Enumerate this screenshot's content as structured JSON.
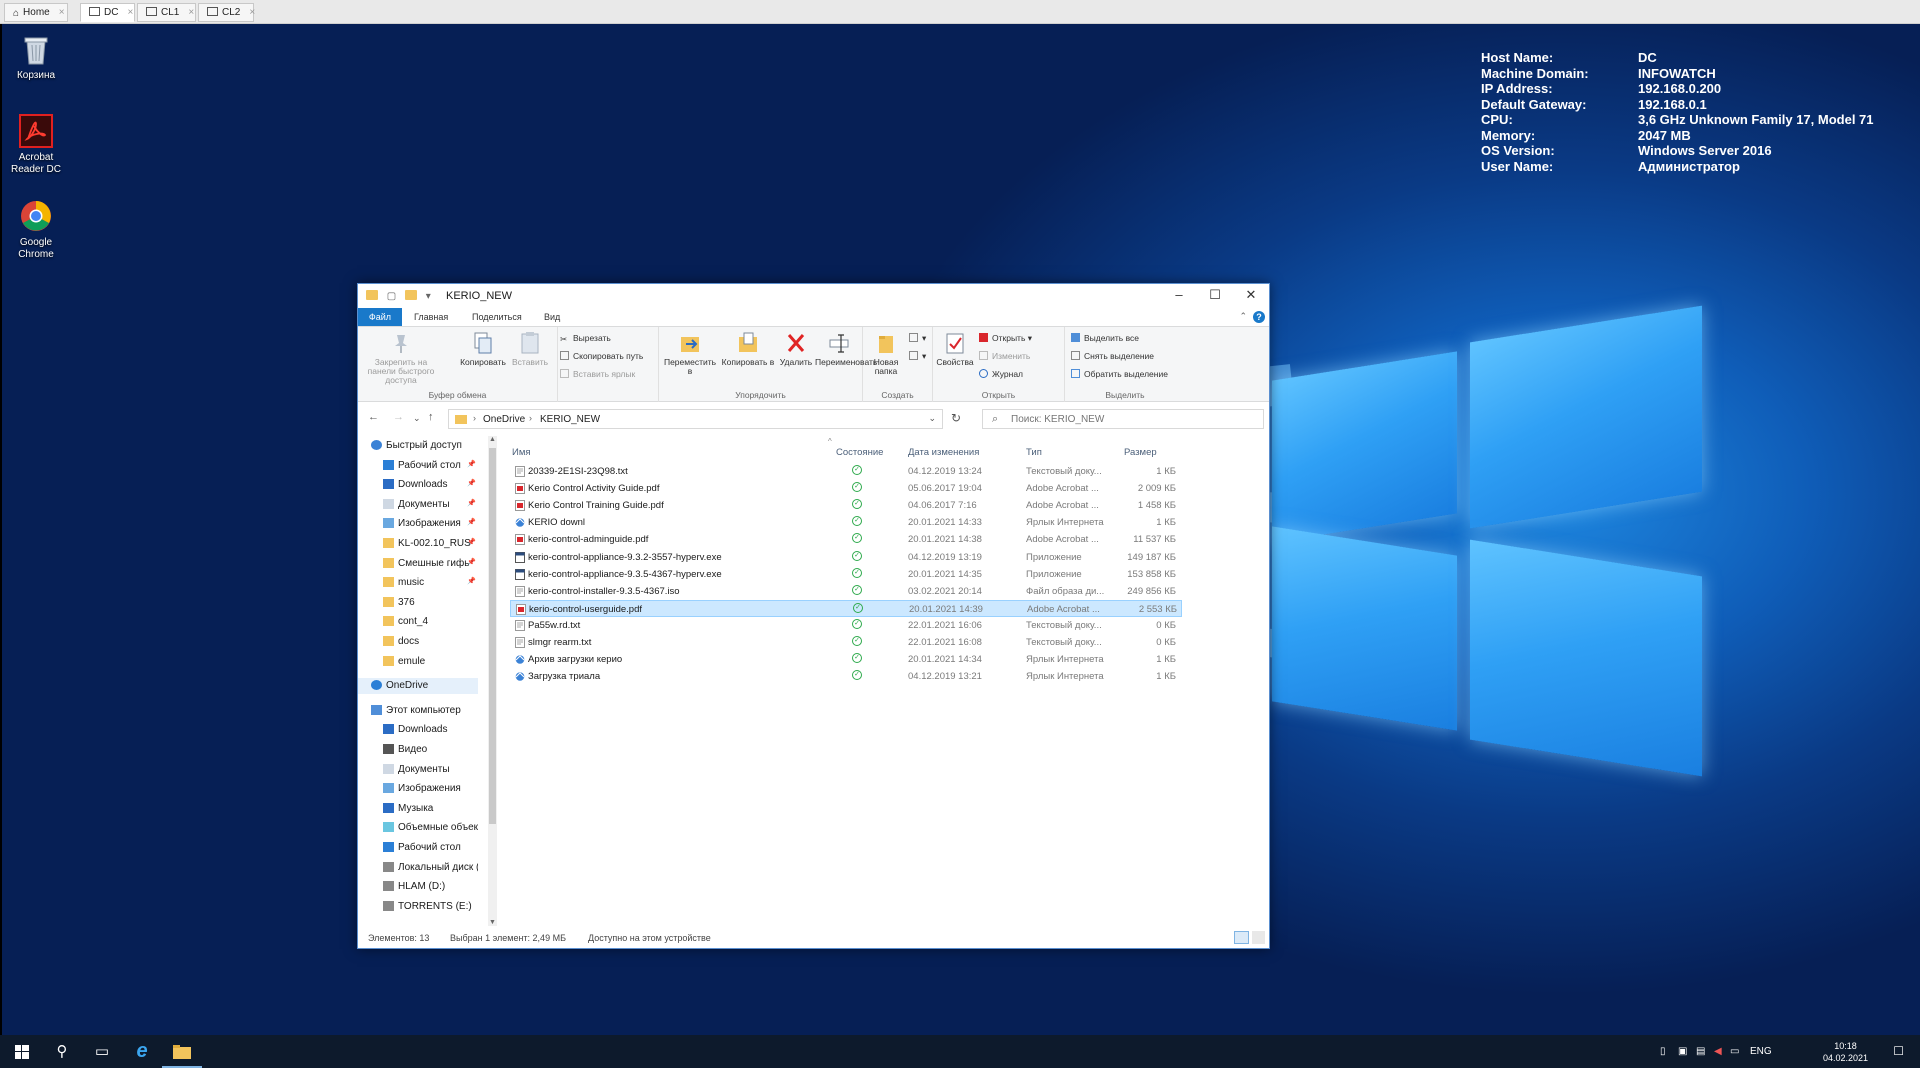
{
  "vm_tabs": [
    {
      "label": "Home",
      "active": false
    },
    {
      "label": "DC",
      "active": true
    },
    {
      "label": "CL1",
      "active": false
    },
    {
      "label": "CL2",
      "active": false
    }
  ],
  "desktop": {
    "icons": [
      {
        "label": "Корзина",
        "icon": "recycle-bin-icon"
      },
      {
        "label": "Acrobat Reader DC",
        "icon": "acrobat-icon"
      },
      {
        "label": "Google Chrome",
        "icon": "chrome-icon"
      }
    ],
    "sysinfo": [
      {
        "k": "Host Name:",
        "v": "DC"
      },
      {
        "k": "Machine Domain:",
        "v": "INFOWATCH"
      },
      {
        "k": "IP Address:",
        "v": "192.168.0.200"
      },
      {
        "k": "Default Gateway:",
        "v": "192.168.0.1"
      },
      {
        "k": "CPU:",
        "v": "3,6 GHz Unknown Family 17, Model 71"
      },
      {
        "k": "Memory:",
        "v": "2047 MB"
      },
      {
        "k": "OS Version:",
        "v": "Windows Server 2016"
      },
      {
        "k": "User Name:",
        "v": "Администратор"
      }
    ]
  },
  "explorer": {
    "title": "KERIO_NEW",
    "ribbon_tabs": [
      "Файл",
      "Главная",
      "Поделиться",
      "Вид"
    ],
    "ribbon": {
      "pin": "Закрепить на панели быстрого доступа",
      "copy": "Копировать",
      "paste": "Вставить",
      "cut": "Вырезать",
      "copy_path": "Скопировать путь",
      "paste_shortcut": "Вставить ярлык",
      "group_clipboard": "Буфер обмена",
      "move_to": "Переместить в",
      "copy_to": "Копировать в",
      "delete": "Удалить",
      "rename": "Переименовать",
      "group_organize": "Упорядочить",
      "new_folder": "Новая папка",
      "group_new": "Создать",
      "properties": "Свойства",
      "open": "Открыть",
      "edit": "Изменить",
      "history": "Журнал",
      "group_open": "Открыть",
      "select_all": "Выделить все",
      "select_none": "Снять выделение",
      "invert": "Обратить выделение",
      "group_select": "Выделить"
    },
    "address": {
      "parts": [
        "OneDrive",
        "KERIO_NEW"
      ]
    },
    "search": {
      "placeholder": "Поиск: KERIO_NEW"
    },
    "nav": [
      {
        "label": "Быстрый доступ",
        "indent": 0,
        "icon": "star-icon",
        "pin": false
      },
      {
        "label": "Рабочий стол",
        "indent": 1,
        "icon": "desktop-icon",
        "pin": true
      },
      {
        "label": "Downloads",
        "indent": 1,
        "icon": "download-icon",
        "pin": true
      },
      {
        "label": "Документы",
        "indent": 1,
        "icon": "documents-icon",
        "pin": true
      },
      {
        "label": "Изображения",
        "indent": 1,
        "icon": "pictures-icon",
        "pin": true
      },
      {
        "label": "KL-002.10_RUS",
        "indent": 1,
        "icon": "folder-icon",
        "pin": true
      },
      {
        "label": "Смешные гифь",
        "indent": 1,
        "icon": "folder-icon",
        "pin": true
      },
      {
        "label": "music",
        "indent": 1,
        "icon": "folder-icon",
        "pin": true
      },
      {
        "label": "376",
        "indent": 1,
        "icon": "folder-icon",
        "pin": false
      },
      {
        "label": "cont_4",
        "indent": 1,
        "icon": "folder-icon",
        "pin": false
      },
      {
        "label": "docs",
        "indent": 1,
        "icon": "folder-icon",
        "pin": false
      },
      {
        "label": "emule",
        "indent": 1,
        "icon": "folder-icon",
        "pin": false
      },
      {
        "label": "OneDrive",
        "indent": 0,
        "icon": "cloud-icon",
        "pin": false,
        "selected": true
      },
      {
        "label": "Этот компьютер",
        "indent": 0,
        "icon": "computer-icon",
        "pin": false
      },
      {
        "label": "Downloads",
        "indent": 1,
        "icon": "download-icon",
        "pin": false
      },
      {
        "label": "Видео",
        "indent": 1,
        "icon": "video-icon",
        "pin": false
      },
      {
        "label": "Документы",
        "indent": 1,
        "icon": "documents-icon",
        "pin": false
      },
      {
        "label": "Изображения",
        "indent": 1,
        "icon": "pictures-icon",
        "pin": false
      },
      {
        "label": "Музыка",
        "indent": 1,
        "icon": "music-icon",
        "pin": false
      },
      {
        "label": "Объемные объек",
        "indent": 1,
        "icon": "3d-objects-icon",
        "pin": false
      },
      {
        "label": "Рабочий стол",
        "indent": 1,
        "icon": "desktop-icon",
        "pin": false
      },
      {
        "label": "Локальный диск (",
        "indent": 1,
        "icon": "drive-icon",
        "pin": false
      },
      {
        "label": "HLAM (D:)",
        "indent": 1,
        "icon": "drive-icon",
        "pin": false
      },
      {
        "label": "TORRENTS (E:)",
        "indent": 1,
        "icon": "drive-icon",
        "pin": false
      }
    ],
    "columns": {
      "name": "Имя",
      "status": "Состояние",
      "date": "Дата изменения",
      "type": "Тип",
      "size": "Размер"
    },
    "files": [
      {
        "name": "20339-2E1SI-23Q98.txt",
        "date": "04.12.2019 13:24",
        "type": "Текстовый доку...",
        "size": "1 КБ",
        "icon": "txt"
      },
      {
        "name": "Kerio Control Activity Guide.pdf",
        "date": "05.06.2017 19:04",
        "type": "Adobe Acrobat ...",
        "size": "2 009 КБ",
        "icon": "pdf"
      },
      {
        "name": "Kerio Control Training Guide.pdf",
        "date": "04.06.2017 7:16",
        "type": "Adobe Acrobat ...",
        "size": "1 458 КБ",
        "icon": "pdf"
      },
      {
        "name": "KERIO downl",
        "date": "20.01.2021 14:33",
        "type": "Ярлык Интернета",
        "size": "1 КБ",
        "icon": "url"
      },
      {
        "name": "kerio-control-adminguide.pdf",
        "date": "20.01.2021 14:38",
        "type": "Adobe Acrobat ...",
        "size": "11 537 КБ",
        "icon": "pdf"
      },
      {
        "name": "kerio-control-appliance-9.3.2-3557-hyperv.exe",
        "date": "04.12.2019 13:19",
        "type": "Приложение",
        "size": "149 187 КБ",
        "icon": "exe"
      },
      {
        "name": "kerio-control-appliance-9.3.5-4367-hyperv.exe",
        "date": "20.01.2021 14:35",
        "type": "Приложение",
        "size": "153 858 КБ",
        "icon": "exe"
      },
      {
        "name": "kerio-control-installer-9.3.5-4367.iso",
        "date": "03.02.2021 20:14",
        "type": "Файл образа ди...",
        "size": "249 856 КБ",
        "icon": "txt"
      },
      {
        "name": "kerio-control-userguide.pdf",
        "date": "20.01.2021 14:39",
        "type": "Adobe Acrobat ...",
        "size": "2 553 КБ",
        "icon": "pdf",
        "selected": true
      },
      {
        "name": "Pa55w.rd.txt",
        "date": "22.01.2021 16:06",
        "type": "Текстовый доку...",
        "size": "0 КБ",
        "icon": "txt"
      },
      {
        "name": "slmgr rearm.txt",
        "date": "22.01.2021 16:08",
        "type": "Текстовый доку...",
        "size": "0 КБ",
        "icon": "txt"
      },
      {
        "name": "Архив загрузки керио",
        "date": "20.01.2021 14:34",
        "type": "Ярлык Интернета",
        "size": "1 КБ",
        "icon": "url"
      },
      {
        "name": "Загрузка триала",
        "date": "04.12.2019 13:21",
        "type": "Ярлык Интернета",
        "size": "1 КБ",
        "icon": "url"
      }
    ],
    "status": {
      "count": "Элементов: 13",
      "selected": "Выбран 1 элемент: 2,49 МБ",
      "availability": "Доступно на этом устройстве"
    }
  },
  "taskbar": {
    "lang": "ENG",
    "time": "10:18",
    "date": "04.02.2021"
  },
  "colors": {
    "accent": "#1979ca",
    "ok": "#2eaa4c",
    "selection": "#cce8ff"
  }
}
